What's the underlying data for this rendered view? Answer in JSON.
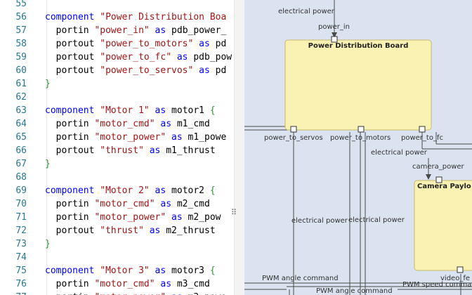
{
  "editor": {
    "lines": [
      {
        "n": "55",
        "t": []
      },
      {
        "n": "56",
        "t": [
          [
            "kw",
            "component "
          ],
          [
            "str",
            "\"Power Distribution Boa"
          ]
        ]
      },
      {
        "n": "57",
        "t": [
          [
            "id",
            "  portin "
          ],
          [
            "str",
            "\"power_in\""
          ],
          [
            "kw",
            " as "
          ],
          [
            "id",
            "pdb_power_"
          ]
        ]
      },
      {
        "n": "58",
        "t": [
          [
            "id",
            "  portout "
          ],
          [
            "str",
            "\"power_to_motors\""
          ],
          [
            "kw",
            " as "
          ],
          [
            "id",
            "pd"
          ]
        ]
      },
      {
        "n": "59",
        "t": [
          [
            "id",
            "  portout "
          ],
          [
            "str",
            "\"power_to_fc\""
          ],
          [
            "kw",
            " as "
          ],
          [
            "id",
            "pdb_pow"
          ]
        ]
      },
      {
        "n": "60",
        "t": [
          [
            "id",
            "  portout "
          ],
          [
            "str",
            "\"power_to_servos\""
          ],
          [
            "kw",
            " as "
          ],
          [
            "id",
            "pd"
          ]
        ]
      },
      {
        "n": "61",
        "t": [
          [
            "brace",
            "}"
          ]
        ]
      },
      {
        "n": "62",
        "t": []
      },
      {
        "n": "63",
        "t": [
          [
            "kw",
            "component "
          ],
          [
            "str",
            "\"Motor 1\""
          ],
          [
            "kw",
            " as "
          ],
          [
            "id",
            "motor1 "
          ],
          [
            "brace",
            "{"
          ]
        ]
      },
      {
        "n": "64",
        "t": [
          [
            "id",
            "  portin "
          ],
          [
            "str",
            "\"motor_cmd\""
          ],
          [
            "kw",
            " as "
          ],
          [
            "id",
            "m1_cmd"
          ]
        ]
      },
      {
        "n": "65",
        "t": [
          [
            "id",
            "  portin "
          ],
          [
            "str",
            "\"motor_power\""
          ],
          [
            "kw",
            " as "
          ],
          [
            "id",
            "m1_powe"
          ]
        ]
      },
      {
        "n": "66",
        "t": [
          [
            "id",
            "  portout "
          ],
          [
            "str",
            "\"thrust\""
          ],
          [
            "kw",
            " as "
          ],
          [
            "id",
            "m1_thrust"
          ]
        ]
      },
      {
        "n": "67",
        "t": [
          [
            "brace",
            "}"
          ]
        ]
      },
      {
        "n": "68",
        "t": []
      },
      {
        "n": "69",
        "t": [
          [
            "kw",
            "component "
          ],
          [
            "str",
            "\"Motor 2\""
          ],
          [
            "kw",
            " as "
          ],
          [
            "id",
            "motor2 "
          ],
          [
            "brace",
            "{"
          ]
        ]
      },
      {
        "n": "70",
        "t": [
          [
            "id",
            "  portin "
          ],
          [
            "str",
            "\"motor_cmd\""
          ],
          [
            "kw",
            " as "
          ],
          [
            "id",
            "m2_cmd"
          ]
        ]
      },
      {
        "n": "71",
        "t": [
          [
            "id",
            "  portin "
          ],
          [
            "str",
            "\"motor_power\""
          ],
          [
            "kw",
            " as "
          ],
          [
            "id",
            "m2_pow"
          ]
        ]
      },
      {
        "n": "72",
        "t": [
          [
            "id",
            "  portout "
          ],
          [
            "str",
            "\"thrust\""
          ],
          [
            "kw",
            " as "
          ],
          [
            "id",
            "m2_thrust"
          ]
        ]
      },
      {
        "n": "73",
        "t": [
          [
            "brace",
            "}"
          ]
        ]
      },
      {
        "n": "74",
        "t": []
      },
      {
        "n": "75",
        "t": [
          [
            "kw",
            "component "
          ],
          [
            "str",
            "\"Motor 3\""
          ],
          [
            "kw",
            " as "
          ],
          [
            "id",
            "motor3 "
          ],
          [
            "brace",
            "{"
          ]
        ]
      },
      {
        "n": "76",
        "t": [
          [
            "id",
            "  portin "
          ],
          [
            "str",
            "\"motor_cmd\""
          ],
          [
            "kw",
            " as "
          ],
          [
            "id",
            "m3_cmd"
          ]
        ]
      },
      {
        "n": "77",
        "t": [
          [
            "id",
            "  portin "
          ],
          [
            "str",
            "\"motor_power\""
          ],
          [
            "kw",
            " as "
          ],
          [
            "id",
            "m3_powe"
          ]
        ]
      }
    ],
    "colors": {
      "keyword": "#0000ff",
      "string": "#a31515",
      "brace": "#319331",
      "linenum": "#237893"
    }
  },
  "splitter": {
    "grip_glyph": "⠿"
  },
  "diagram": {
    "box_pdb_title": "Power Distribution Board",
    "box_camera_title": "Camera Paylo",
    "port_power_in": "power_in",
    "port_power_to_servos": "power_to_servos",
    "port_power_to_motors": "power_to_motors",
    "port_power_to_fc": "power_to_fc",
    "port_camera_power": "camera_power",
    "port_video_fe": "video_fe",
    "edge_electrical_power_top": "electrical power",
    "edge_electrical_power_right": "electrical power",
    "edge_electrical_power_mid_left": "electrical power",
    "edge_electrical_power_mid_right": "electrical power",
    "edge_pwm_angle_1": "PWM angle command",
    "edge_pwm_angle_2": "PWM angle command",
    "edge_pwm_speed": "PWM speed comma",
    "colors": {
      "background": "#dbe2f0",
      "box_fill": "#faf2b3",
      "box_stroke": "#c9b96a",
      "edge": "#4a4a4a"
    }
  }
}
